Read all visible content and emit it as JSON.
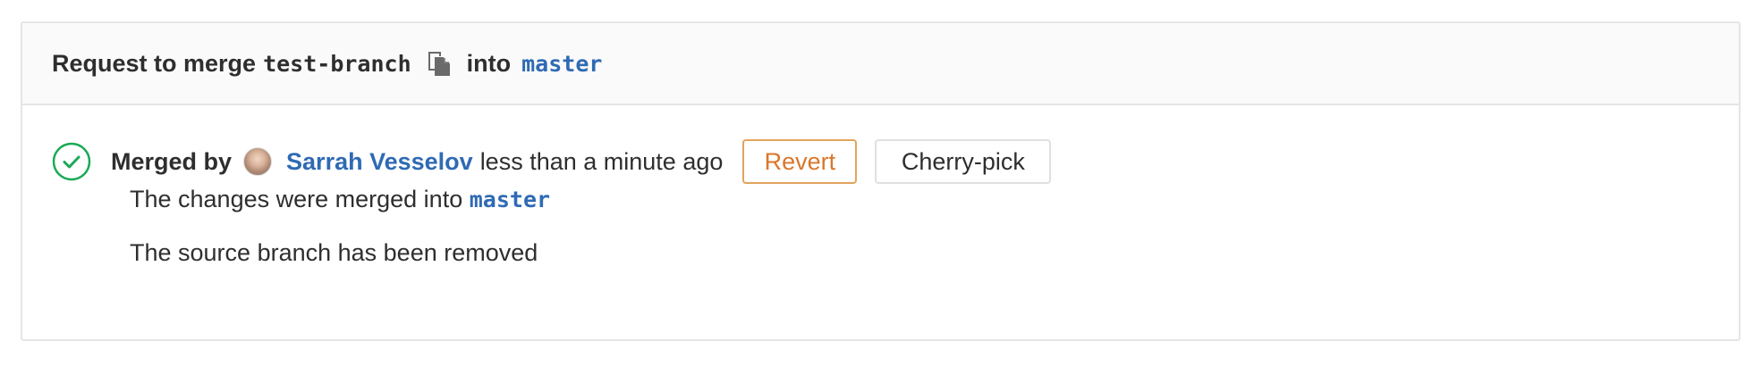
{
  "header": {
    "prefix": "Request to merge",
    "source_branch": "test-branch",
    "copy_icon": "copy-icon",
    "into": "into",
    "target_branch": "master"
  },
  "status": {
    "icon": "check-circle-icon",
    "merged_by_label": "Merged by",
    "author_name": "Sarrah Vesselov",
    "time": "less than a minute ago",
    "revert_label": "Revert",
    "cherry_pick_label": "Cherry-pick"
  },
  "messages": {
    "merged_into_text": "The changes were merged into",
    "merged_into_branch": "master",
    "source_removed": "The source branch has been removed"
  },
  "colors": {
    "link": "#2f6ab4",
    "success": "#1aaa55",
    "revert": "#d9772b",
    "border": "#e5e5e5"
  }
}
